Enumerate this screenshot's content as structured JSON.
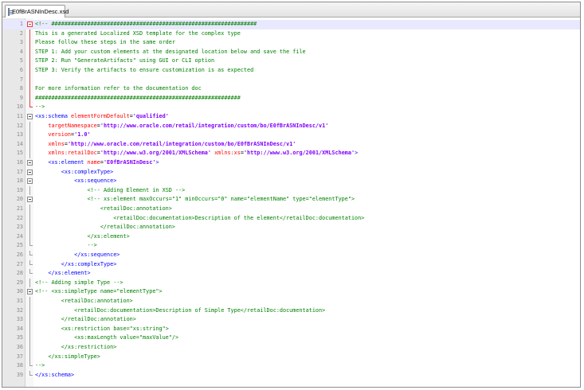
{
  "tab": {
    "filename": "E0fBrASNInDesc.xsd"
  },
  "current_line": 1,
  "lines": [
    {
      "n": "1",
      "fold": "box-red",
      "segs": [
        [
          "cmt",
          "<!-- ###############################################################"
        ]
      ]
    },
    {
      "n": "2",
      "fold": "line-red",
      "segs": [
        [
          "cmt",
          "This is a generated Localized XSD template for the complex type"
        ]
      ]
    },
    {
      "n": "3",
      "fold": "line-red",
      "segs": [
        [
          "cmt",
          "Please follow these steps in the same order"
        ]
      ]
    },
    {
      "n": "4",
      "fold": "line-red",
      "segs": [
        [
          "cmt",
          "STEP 1: Add your custom elements at the designated location below and save the file"
        ]
      ]
    },
    {
      "n": "5",
      "fold": "line-red",
      "segs": [
        [
          "cmt",
          "STEP 2: Run \"GenerateArtifacts\" using GUI or CLI option"
        ]
      ]
    },
    {
      "n": "6",
      "fold": "line-red",
      "segs": [
        [
          "cmt",
          "STEP 3: Verify the artifacts to ensure customization is as expected"
        ]
      ]
    },
    {
      "n": "7",
      "fold": "line-red",
      "segs": [
        [
          "cmt",
          ""
        ]
      ]
    },
    {
      "n": "8",
      "fold": "line-red",
      "segs": [
        [
          "cmt",
          "For more information refer to the documentation doc"
        ]
      ]
    },
    {
      "n": "9",
      "fold": "line-red",
      "segs": [
        [
          "cmt",
          "###############################################################"
        ]
      ]
    },
    {
      "n": "10",
      "fold": "end-red",
      "segs": [
        [
          "cmt",
          "-->"
        ]
      ]
    },
    {
      "n": "11",
      "fold": "box",
      "segs": [
        [
          "tag",
          "<xs:schema "
        ],
        [
          "attr",
          "elementFormDefault"
        ],
        [
          "plain",
          "="
        ],
        [
          "val",
          "'qualified'"
        ]
      ]
    },
    {
      "n": "12",
      "fold": "line",
      "segs": [
        [
          "plain",
          "    "
        ],
        [
          "attr",
          "targetNamespace"
        ],
        [
          "plain",
          "="
        ],
        [
          "val",
          "'http://www.oracle.com/retail/integration/custom/bo/E0fBrASNInDesc/v1'"
        ]
      ]
    },
    {
      "n": "13",
      "fold": "line",
      "segs": [
        [
          "plain",
          "    "
        ],
        [
          "attr",
          "version"
        ],
        [
          "plain",
          "="
        ],
        [
          "val",
          "'1.0'"
        ]
      ]
    },
    {
      "n": "14",
      "fold": "line",
      "segs": [
        [
          "plain",
          "    "
        ],
        [
          "attr",
          "xmlns"
        ],
        [
          "plain",
          "="
        ],
        [
          "val",
          "'http://www.oracle.com/retail/integration/custom/bo/E0fBrASNInDesc/v1'"
        ]
      ]
    },
    {
      "n": "15",
      "fold": "line",
      "segs": [
        [
          "plain",
          "    "
        ],
        [
          "attr",
          "xmlns:retailDoc"
        ],
        [
          "plain",
          "="
        ],
        [
          "val",
          "'http://www.w3.org/2001/XMLSchema'"
        ],
        [
          "plain",
          " "
        ],
        [
          "attr",
          "xmlns:xs"
        ],
        [
          "plain",
          "="
        ],
        [
          "val",
          "'http://www.w3.org/2001/XMLSchema'"
        ],
        [
          "tag",
          ">"
        ]
      ]
    },
    {
      "n": "16",
      "fold": "box",
      "segs": [
        [
          "plain",
          "    "
        ],
        [
          "tag",
          "<xs:element "
        ],
        [
          "attr",
          "name"
        ],
        [
          "plain",
          "="
        ],
        [
          "val",
          "'E0fBrASNInDesc'"
        ],
        [
          "tag",
          ">"
        ]
      ]
    },
    {
      "n": "17",
      "fold": "box",
      "segs": [
        [
          "plain",
          "        "
        ],
        [
          "tag",
          "<xs:complexType>"
        ]
      ]
    },
    {
      "n": "18",
      "fold": "box",
      "segs": [
        [
          "plain",
          "            "
        ],
        [
          "tag",
          "<xs:sequence>"
        ]
      ]
    },
    {
      "n": "19",
      "fold": "line",
      "segs": [
        [
          "plain",
          "                "
        ],
        [
          "cmt",
          "<!-- Adding Element in XSD -->"
        ]
      ]
    },
    {
      "n": "20",
      "fold": "box",
      "segs": [
        [
          "plain",
          "                "
        ],
        [
          "cmt",
          "<!-- xs:element maxOccurs=\"1\" minOccurs=\"0\" name=\"elementName\" type=\"elementType\">"
        ]
      ]
    },
    {
      "n": "21",
      "fold": "line",
      "segs": [
        [
          "plain",
          "                    "
        ],
        [
          "cmt",
          "<retailDoc:annotation>"
        ]
      ]
    },
    {
      "n": "22",
      "fold": "line",
      "segs": [
        [
          "plain",
          "                        "
        ],
        [
          "cmt",
          "<retailDoc:documentation>Description of the element</retailDoc:documentation>"
        ]
      ]
    },
    {
      "n": "23",
      "fold": "line",
      "segs": [
        [
          "plain",
          "                    "
        ],
        [
          "cmt",
          "</retailDoc:annotation>"
        ]
      ]
    },
    {
      "n": "24",
      "fold": "line",
      "segs": [
        [
          "plain",
          "                "
        ],
        [
          "cmt",
          "</xs:element>"
        ]
      ]
    },
    {
      "n": "25",
      "fold": "end",
      "segs": [
        [
          "plain",
          "                "
        ],
        [
          "cmt",
          "-->"
        ]
      ]
    },
    {
      "n": "26",
      "fold": "end",
      "segs": [
        [
          "plain",
          "            "
        ],
        [
          "tag",
          "</xs:sequence>"
        ]
      ]
    },
    {
      "n": "27",
      "fold": "end",
      "segs": [
        [
          "plain",
          "        "
        ],
        [
          "tag",
          "</xs:complexType>"
        ]
      ]
    },
    {
      "n": "28",
      "fold": "end",
      "segs": [
        [
          "plain",
          "    "
        ],
        [
          "tag",
          "</xs:element>"
        ]
      ]
    },
    {
      "n": "29",
      "fold": "line",
      "segs": [
        [
          "cmt",
          "<!-- Adding simple Type -->"
        ]
      ]
    },
    {
      "n": "30",
      "fold": "box",
      "segs": [
        [
          "cmt",
          "<!-- <xs:simpleType name=\"elementType\">"
        ]
      ]
    },
    {
      "n": "31",
      "fold": "line",
      "segs": [
        [
          "plain",
          "        "
        ],
        [
          "cmt",
          "<retailDoc:annotation>"
        ]
      ]
    },
    {
      "n": "32",
      "fold": "line",
      "segs": [
        [
          "plain",
          "            "
        ],
        [
          "cmt",
          "<retailDoc:documentation>Description of Simple Type</retailDoc:documentation>"
        ]
      ]
    },
    {
      "n": "33",
      "fold": "line",
      "segs": [
        [
          "plain",
          "        "
        ],
        [
          "cmt",
          "</retailDoc:annotation>"
        ]
      ]
    },
    {
      "n": "34",
      "fold": "line",
      "segs": [
        [
          "plain",
          "        "
        ],
        [
          "cmt",
          "<xs:restriction base=\"xs:string\">"
        ]
      ]
    },
    {
      "n": "35",
      "fold": "line",
      "segs": [
        [
          "plain",
          "            "
        ],
        [
          "cmt",
          "<xs:maxLength value=\"maxValue\"/>"
        ]
      ]
    },
    {
      "n": "36",
      "fold": "line",
      "segs": [
        [
          "plain",
          "        "
        ],
        [
          "cmt",
          "</xs:restriction>"
        ]
      ]
    },
    {
      "n": "37",
      "fold": "line",
      "segs": [
        [
          "plain",
          "    "
        ],
        [
          "cmt",
          "</xs:simpleType>"
        ]
      ]
    },
    {
      "n": "38",
      "fold": "end",
      "segs": [
        [
          "cmt",
          "-->"
        ]
      ]
    },
    {
      "n": "39",
      "fold": "end",
      "segs": [
        [
          "tag",
          "</xs:schema>"
        ]
      ]
    }
  ]
}
